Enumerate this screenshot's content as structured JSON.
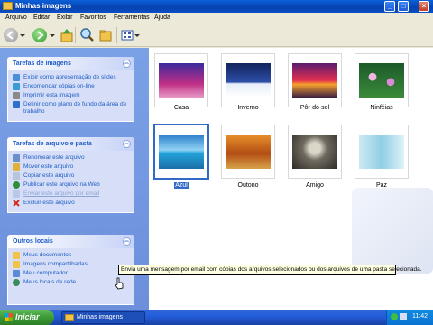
{
  "window": {
    "title": "Minhas imagens"
  },
  "menubar": {
    "items": [
      "Arquivo",
      "Editar",
      "Exibir",
      "Favoritos",
      "Ferramentas",
      "Ajuda"
    ]
  },
  "toolbar": {
    "icons": [
      "back-icon",
      "forward-icon",
      "up-folder-icon",
      "search-icon",
      "folders-icon",
      "views-icon"
    ]
  },
  "sidebar": {
    "image_tasks": {
      "title": "Tarefas de imagens",
      "items": [
        {
          "label": "Exibir como apresentação de slides",
          "icon": "slideshow-icon"
        },
        {
          "label": "Encomendar cópias on-line",
          "icon": "order-prints-icon"
        },
        {
          "label": "Imprimir esta imagem",
          "icon": "print-icon"
        },
        {
          "label": "Definir como plano de fundo da área de trabalho",
          "icon": "desktop-background-icon"
        }
      ]
    },
    "file_tasks": {
      "title": "Tarefas de arquivo e pasta",
      "items": [
        {
          "label": "Renomear este arquivo",
          "icon": "rename-icon"
        },
        {
          "label": "Mover este arquivo",
          "icon": "move-icon"
        },
        {
          "label": "Copiar este arquivo",
          "icon": "copy-icon"
        },
        {
          "label": "Publicar este arquivo na Web",
          "icon": "web-publish-icon"
        },
        {
          "label": "Enviar este arquivo por email",
          "icon": "email-icon"
        },
        {
          "label": "Excluir este arquivo",
          "icon": "delete-icon"
        }
      ]
    },
    "other_places": {
      "title": "Outros locais",
      "items": [
        {
          "label": "Meus documentos",
          "icon": "documents-icon"
        },
        {
          "label": "Imagens compartilhadas",
          "icon": "shared-pictures-icon"
        },
        {
          "label": "Meu computador",
          "icon": "computer-icon"
        },
        {
          "label": "Meus locais de rede",
          "icon": "network-icon"
        }
      ]
    }
  },
  "files": [
    {
      "name": "Casa",
      "selected": false
    },
    {
      "name": "Inverno",
      "selected": false
    },
    {
      "name": "Pôr-do-sol",
      "selected": false
    },
    {
      "name": "Ninféias",
      "selected": false
    },
    {
      "name": "Azul",
      "selected": true
    },
    {
      "name": "Outono",
      "selected": false
    },
    {
      "name": "Amigo",
      "selected": false
    },
    {
      "name": "Paz",
      "selected": false
    }
  ],
  "tooltip": {
    "text": "Envia uma mensagem por email com cópias dos arquivos selecionados ou dos arquivos de uma pasta selecionada."
  },
  "taskbar": {
    "start_label": "Iniciar",
    "task_button": "Minhas imagens",
    "clock": "11:42"
  },
  "colors": {
    "title_blue": "#0a4fc6",
    "task_link": "#215dc6",
    "taskpane_bg": "#7aa1e6",
    "selection": "#316ac5",
    "start_green": "#3c9a35",
    "tooltip_bg": "#ffffe1"
  }
}
